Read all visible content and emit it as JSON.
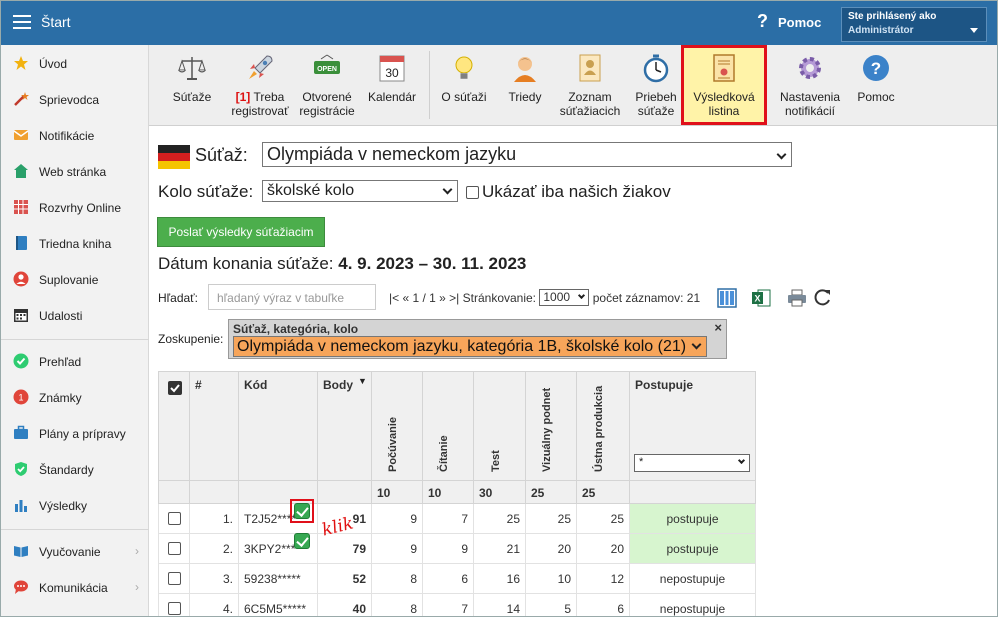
{
  "topbar": {
    "title": "Štart",
    "help_icon": "?",
    "help_label": "Pomoc",
    "user_line1": "Ste prihlásený ako",
    "user_line2": "Administrátor",
    "color": "#2b6ea6"
  },
  "sidebar": {
    "items": [
      {
        "label": "Úvod",
        "icon": "star-icon"
      },
      {
        "label": "Sprievodca",
        "icon": "magic-wand-icon"
      },
      {
        "label": "Notifikácie",
        "icon": "envelope-icon"
      },
      {
        "label": "Web stránka",
        "icon": "house-icon"
      },
      {
        "label": "Rozvrhy Online",
        "icon": "calendar-grid-icon"
      },
      {
        "label": "Triedna kniha",
        "icon": "book-icon"
      },
      {
        "label": "Suplovanie",
        "icon": "person-icon"
      },
      {
        "label": "Udalosti",
        "icon": "calendar-icon"
      },
      {
        "label": "Prehľad",
        "icon": "check-circle-icon"
      },
      {
        "label": "Známky",
        "icon": "grade-icon"
      },
      {
        "label": "Plány a prípravy",
        "icon": "briefcase-icon"
      },
      {
        "label": "Štandardy",
        "icon": "shield-check-icon"
      },
      {
        "label": "Výsledky",
        "icon": "bar-chart-icon"
      },
      {
        "label": "Vyučovanie",
        "icon": "open-book-icon"
      },
      {
        "label": "Komunikácia",
        "icon": "chat-icon"
      }
    ]
  },
  "toolbar": {
    "items": [
      {
        "label": "Súťaže",
        "label2": ""
      },
      {
        "badge": "[1]",
        "label": "Treba",
        "label2": "registrovať"
      },
      {
        "label": "Otvorené",
        "label2": "registrácie",
        "sign": "OPEN"
      },
      {
        "label": "Kalendár",
        "label2": "",
        "day": "30"
      },
      {
        "label": "O súťaži",
        "label2": ""
      },
      {
        "label": "Triedy",
        "label2": ""
      },
      {
        "label": "Zoznam",
        "label2": "súťažiacich"
      },
      {
        "label": "Priebeh",
        "label2": "súťaže"
      },
      {
        "label": "Výsledková",
        "label2": "listina"
      },
      {
        "label": "Nastavenia",
        "label2": "notifikácií"
      },
      {
        "label": "Pomoc",
        "label2": "",
        "glyph": "?"
      }
    ]
  },
  "contest": {
    "label": "Súťaž:",
    "value": "Olympiáda v nemeckom jazyku",
    "round_label": "Kolo súťaže:",
    "round_value": "školské kolo",
    "only_ours_label": "Ukázať iba našich žiakov",
    "send_button": "Poslať výsledky súťažiacim",
    "date_label": "Dátum konania súťaže:",
    "date_value": "4. 9. 2023 – 30. 11. 2023"
  },
  "search": {
    "label": "Hľadať:",
    "placeholder": "hľadaný výraz v tabuľke",
    "pager_nav": "|< « 1 / 1 » >|",
    "paging_label": "Stránkovanie:",
    "paging_value": "1000",
    "count_label": "počet záznamov: 21"
  },
  "group": {
    "label": "Zoskupenie:",
    "title": "Súťaž, kategória, kolo",
    "close": "×",
    "value": "Olympiáda v nemeckom jazyku, kategória 1B, školské kolo (21)"
  },
  "table": {
    "headers": {
      "num": "#",
      "code": "Kód",
      "points": "Body",
      "listening": "Počúvanie",
      "reading": "Čítanie",
      "test": "Test",
      "visual": "Vizuálny podnet",
      "oral": "Ústna produkcia",
      "advances": "Postupuje",
      "filter": "*"
    },
    "max": {
      "listening": "10",
      "reading": "10",
      "test": "30",
      "visual": "25",
      "oral": "25"
    },
    "rows": [
      {
        "n": "1.",
        "code": "T2J52*****",
        "points": "91",
        "listening": "9",
        "reading": "7",
        "test": "25",
        "visual": "25",
        "oral": "25",
        "status": "postupuje"
      },
      {
        "n": "2.",
        "code": "3KPY2*****",
        "points": "79",
        "listening": "9",
        "reading": "9",
        "test": "21",
        "visual": "20",
        "oral": "20",
        "status": "postupuje"
      },
      {
        "n": "3.",
        "code": "59238*****",
        "points": "52",
        "listening": "8",
        "reading": "6",
        "test": "16",
        "visual": "10",
        "oral": "12",
        "status": "nepostupuje"
      },
      {
        "n": "4.",
        "code": "6C5M5*****",
        "points": "40",
        "listening": "8",
        "reading": "7",
        "test": "14",
        "visual": "5",
        "oral": "6",
        "status": "nepostupuje"
      }
    ],
    "annotation": "klik"
  }
}
